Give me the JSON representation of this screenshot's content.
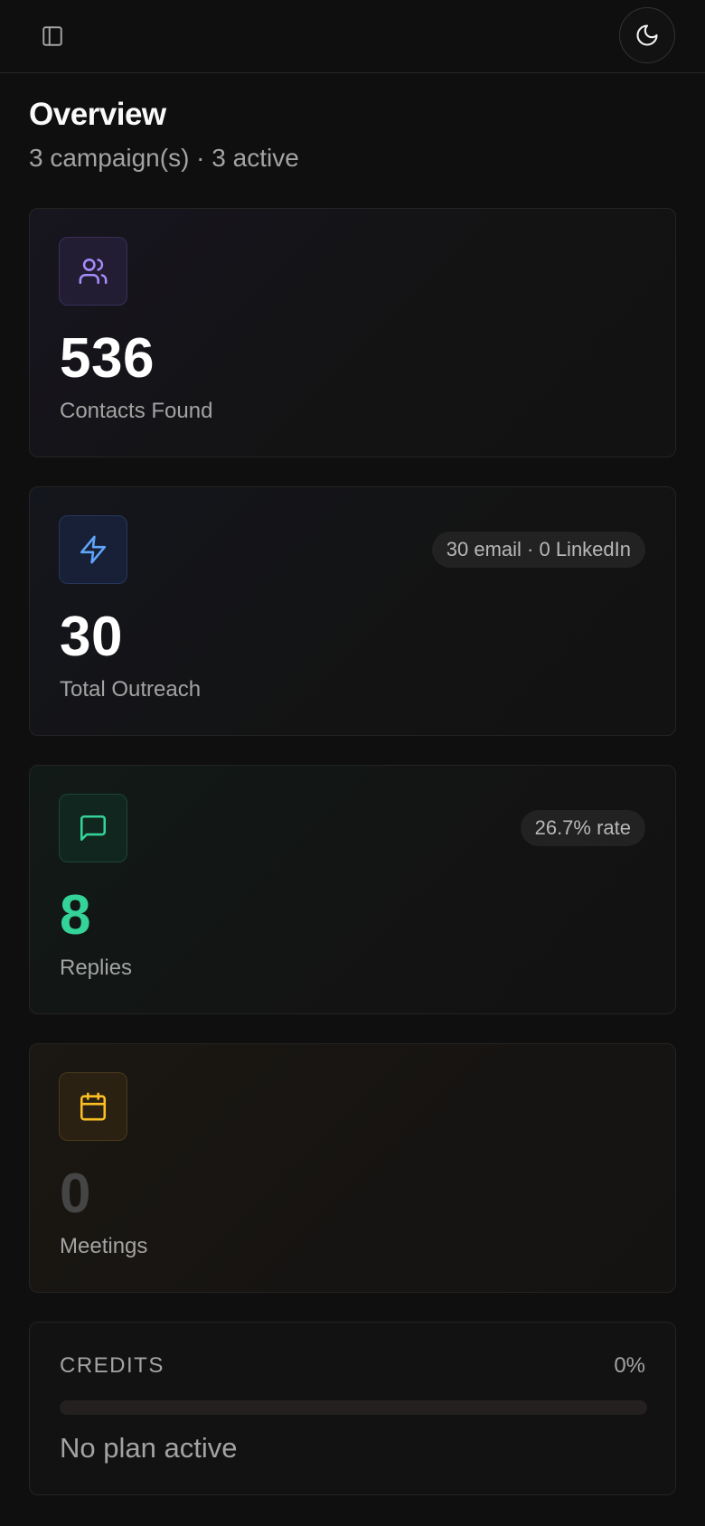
{
  "header": {
    "title": "Overview",
    "subtitle": "3 campaign(s) · 3 active"
  },
  "stats": [
    {
      "value": "536",
      "label": "Contacts Found",
      "icon": "users-icon",
      "accent": "#a78bfa"
    },
    {
      "value": "30",
      "label": "Total Outreach",
      "icon": "zap-icon",
      "accent": "#60a5fa",
      "badge": "30 email · 0 LinkedIn"
    },
    {
      "value": "8",
      "label": "Replies",
      "icon": "message-square-icon",
      "accent": "#34d399",
      "badge": "26.7% rate"
    },
    {
      "value": "0",
      "label": "Meetings",
      "icon": "calendar-icon",
      "accent": "#fbbf24"
    }
  ],
  "credits": {
    "label": "CREDITS",
    "percent": "0%",
    "progress": 0,
    "status": "No plan active"
  }
}
